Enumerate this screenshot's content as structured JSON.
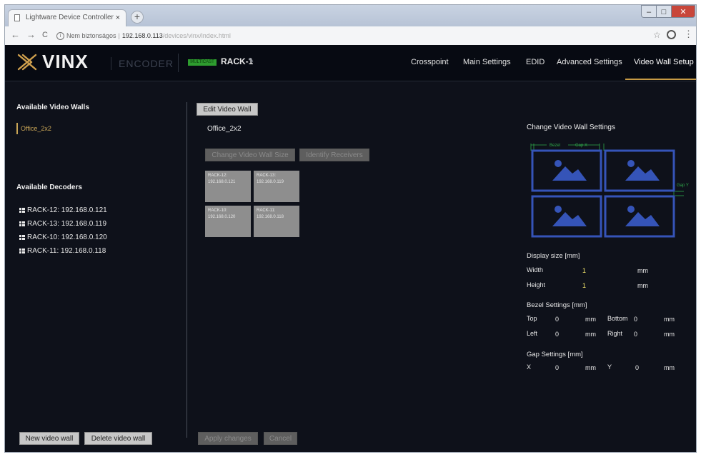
{
  "browser": {
    "tab_title": "Lightware Device Controller",
    "tab_close": "×",
    "new_tab": "+",
    "back": "←",
    "forward": "→",
    "reload": "C",
    "security_label": "Nem biztonságos",
    "url_host": "192.168.0.113",
    "url_path": "/devices/vinx/index.html",
    "star": "☆",
    "menu": "⋮",
    "win_min": "–",
    "win_max": "□",
    "win_close": "✕"
  },
  "header": {
    "logo": "VINX",
    "product": "ENCODER",
    "status_badge": "MULTICAST",
    "device_name": "RACK-1",
    "edit_glyph": "✎",
    "menu": [
      "Crosspoint",
      "Main Settings",
      "EDID",
      "Advanced Settings",
      "Video Wall Setup"
    ],
    "active_menu": "Video Wall Setup",
    "accent_color": "#c79a45"
  },
  "left": {
    "walls_title": "Available Video Walls",
    "walls": [
      "Office_2x2"
    ],
    "decoders_title": "Available Decoders",
    "decoders": [
      "RACK-12: 192.168.0.121",
      "RACK-13: 192.168.0.119",
      "RACK-10: 192.168.0.120",
      "RACK-11: 192.168.0.118"
    ],
    "new_button": "New video wall",
    "delete_button": "Delete video wall"
  },
  "center": {
    "edit_button": "Edit Video Wall",
    "wall_name": "Office_2x2",
    "change_size_button": "Change Video Wall Size",
    "identify_button": "Identify Receivers",
    "tiles": [
      {
        "name": "RACK-12:",
        "ip": "192.168.0.121"
      },
      {
        "name": "RACK-13:",
        "ip": "192.168.0.119"
      },
      {
        "name": "RACK-10:",
        "ip": "192.168.0.120"
      },
      {
        "name": "RACK-11:",
        "ip": "192.168.0.118"
      }
    ],
    "apply_button": "Apply changes",
    "cancel_button": "Cancel"
  },
  "settings": {
    "title": "Change Video Wall Settings",
    "diagram_bezel": "Bezel",
    "diagram_gap_x": "Gap X",
    "diagram_gap_y": "Gap Y",
    "display_size_title": "Display size [mm]",
    "width_label": "Width",
    "width_value": "1",
    "height_label": "Height",
    "height_value": "1",
    "unit": "mm",
    "bezel_title": "Bezel Settings [mm]",
    "top_label": "Top",
    "top_value": "0",
    "bottom_label": "Bottom",
    "bottom_value": "0",
    "left_label": "Left",
    "left_value": "0",
    "right_label": "Right",
    "right_value": "0",
    "gap_title": "Gap Settings [mm]",
    "x_label": "X",
    "x_value": "0",
    "y_label": "Y",
    "y_value": "0"
  }
}
